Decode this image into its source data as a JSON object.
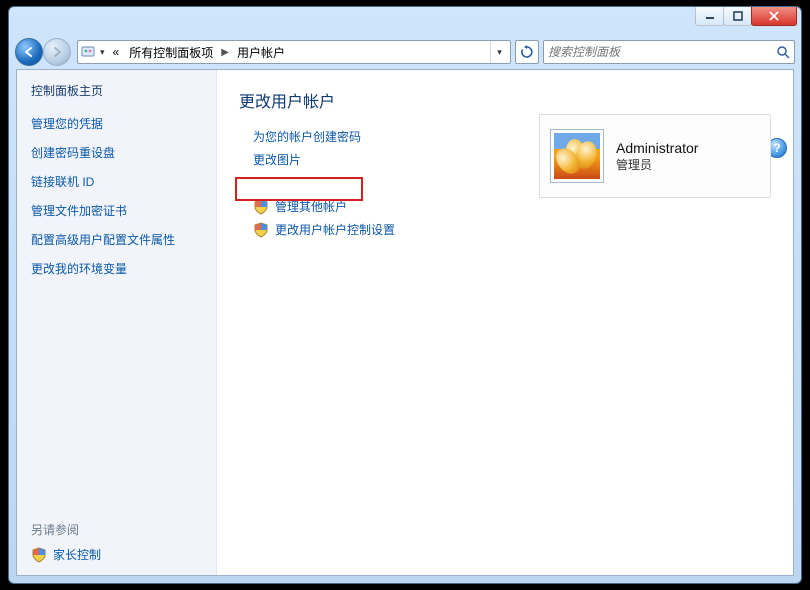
{
  "window": {
    "min_tooltip": "Minimize",
    "max_tooltip": "Maximize",
    "close_tooltip": "Close"
  },
  "nav": {
    "back_tooltip": "Back",
    "forward_tooltip": "Forward",
    "crumb_prefix": "«",
    "crumb1": "所有控制面板项",
    "crumb2": "用户帐户",
    "dropdown_tooltip": "▾",
    "refresh_tooltip": "Refresh"
  },
  "search": {
    "placeholder": "搜索控制面板",
    "icon_name": "search"
  },
  "help": {
    "label": "?"
  },
  "sidebar": {
    "home": "控制面板主页",
    "tasks": [
      "管理您的凭据",
      "创建密码重设盘",
      "链接联机 ID",
      "管理文件加密证书",
      "配置高级用户配置文件属性",
      "更改我的环境变量"
    ],
    "seealso_title": "另请参阅",
    "seealso_item": "家长控制"
  },
  "main": {
    "heading": "更改用户帐户",
    "links": {
      "create_password": "为您的帐户创建密码",
      "change_picture": "更改图片",
      "manage_other_accounts": "管理其他帐户",
      "change_uac_settings": "更改用户帐户控制设置"
    }
  },
  "account": {
    "name": "Administrator",
    "role": "管理员"
  }
}
